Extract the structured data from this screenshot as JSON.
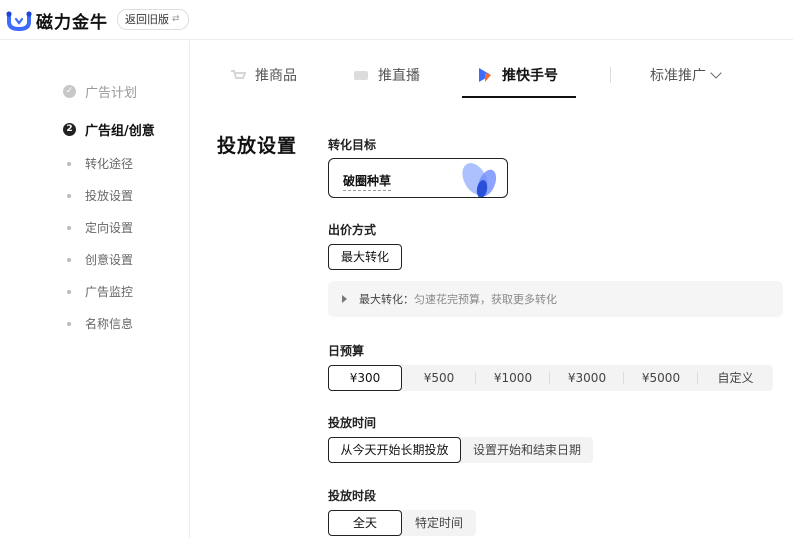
{
  "header": {
    "brand": "磁力金牛",
    "back_button": "返回旧版",
    "back_icon": "swap-icon"
  },
  "sidebar": {
    "steps": [
      {
        "label": "广告计划",
        "state": "done",
        "marker": "✓"
      },
      {
        "label": "广告组/创意",
        "state": "active",
        "marker": "2"
      }
    ],
    "sub_items": [
      "转化途径",
      "投放设置",
      "定向设置",
      "创意设置",
      "广告监控",
      "名称信息"
    ]
  },
  "tabs": {
    "items": [
      {
        "label": "推商品",
        "icon": "cart-icon"
      },
      {
        "label": "推直播",
        "icon": "live-icon"
      },
      {
        "label": "推快手号",
        "icon": "kuaishou-icon"
      }
    ],
    "active_index": 2,
    "more_label": "标准推广"
  },
  "main": {
    "section_title": "投放设置",
    "conversion_goal": {
      "label": "转化目标",
      "value": "破圈种草"
    },
    "bid_method": {
      "label": "出价方式",
      "value": "最大转化",
      "tip_title": "最大转化：",
      "tip_body": "匀速花完预算，获取更多转化"
    },
    "daily_budget": {
      "label": "日预算",
      "options": [
        "¥300",
        "¥500",
        "¥1000",
        "¥3000",
        "¥5000",
        "自定义"
      ],
      "selected_index": 0
    },
    "schedule_time": {
      "label": "投放时间",
      "options": [
        "从今天开始长期投放",
        "设置开始和结束日期"
      ],
      "selected_index": 0
    },
    "schedule_period": {
      "label": "投放时段",
      "options": [
        "全天",
        "特定时间"
      ],
      "selected_index": 0
    }
  },
  "colors": {
    "accent": "#3d6bff",
    "active_border": "#222222",
    "tip_bg": "#f5f5f5"
  }
}
